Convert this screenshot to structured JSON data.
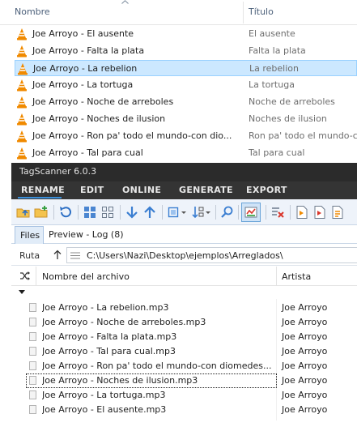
{
  "explorer": {
    "col_name": "Nombre",
    "col_title": "Título",
    "rows": [
      {
        "name": "Joe Arroyo - El ausente",
        "title": "El ausente",
        "selected": false
      },
      {
        "name": "Joe Arroyo - Falta la plata",
        "title": "Falta la plata",
        "selected": false
      },
      {
        "name": "Joe Arroyo - La rebelion",
        "title": "La rebelion",
        "selected": true
      },
      {
        "name": "Joe Arroyo - La tortuga",
        "title": "La tortuga",
        "selected": false
      },
      {
        "name": "Joe Arroyo - Noche de arreboles",
        "title": "Noche de arreboles",
        "selected": false
      },
      {
        "name": "Joe Arroyo - Noches de ilusion",
        "title": "Noches de ilusion",
        "selected": false
      },
      {
        "name": "Joe Arroyo - Ron pa' todo el mundo-con dio...",
        "title": "Ron pa' todo el mundo-c",
        "selected": false
      },
      {
        "name": "Joe Arroyo - Tal para cual",
        "title": "Tal para cual",
        "selected": false
      }
    ],
    "file_icon": "vlc-cone-icon"
  },
  "tagscanner": {
    "title": "TagScanner 6.0.3",
    "menu": [
      "RENAME",
      "EDIT",
      "ONLINE",
      "GENERATE",
      "EXPORT"
    ],
    "active_menu": "RENAME",
    "toolbar_icons": [
      "open-folder-icon",
      "add-folder-icon",
      "refresh-icon",
      "grid-view-icon",
      "thumbnail-view-icon",
      "move-down-icon",
      "move-up-icon",
      "select-dropdown-icon",
      "sort-dropdown-icon",
      "search-icon",
      "compare-icon",
      "clear-list-icon",
      "export-icon",
      "export-alt-icon"
    ],
    "tabs": {
      "files": "Files",
      "preview": "Preview - Log (8)"
    },
    "path_label": "Ruta",
    "path_value": "C:\\Users\\Nazi\\Desktop\\ejemplos\\Arreglados\\",
    "grid_headers": {
      "file": "Nombre del archivo",
      "artist": "Artista"
    },
    "files": [
      {
        "name": "Joe Arroyo - La rebelion.mp3",
        "artist": "Joe Arroyo",
        "focused": false
      },
      {
        "name": "Joe Arroyo - Noche de arreboles.mp3",
        "artist": "Joe Arroyo",
        "focused": false
      },
      {
        "name": "Joe Arroyo - Falta la plata.mp3",
        "artist": "Joe Arroyo",
        "focused": false
      },
      {
        "name": "Joe Arroyo - Tal para cual.mp3",
        "artist": "Joe Arroyo",
        "focused": false
      },
      {
        "name": "Joe Arroyo - Ron pa' todo el mundo-con diomedes....",
        "artist": "Joe Arroyo",
        "focused": false
      },
      {
        "name": "Joe Arroyo - Noches de ilusion.mp3",
        "artist": "Joe Arroyo",
        "focused": true
      },
      {
        "name": "Joe Arroyo - La tortuga.mp3",
        "artist": "Joe Arroyo",
        "focused": false
      },
      {
        "name": "Joe Arroyo - El ausente.mp3",
        "artist": "Joe Arroyo",
        "focused": false
      }
    ]
  },
  "colors": {
    "selection_bg": "#cce8ff",
    "selection_border": "#99d1ff",
    "titlebar_bg": "#2b2b2b",
    "menubar_bg": "#343434",
    "accent": "#3b8fd9",
    "vlc_orange": "#f08a00"
  }
}
